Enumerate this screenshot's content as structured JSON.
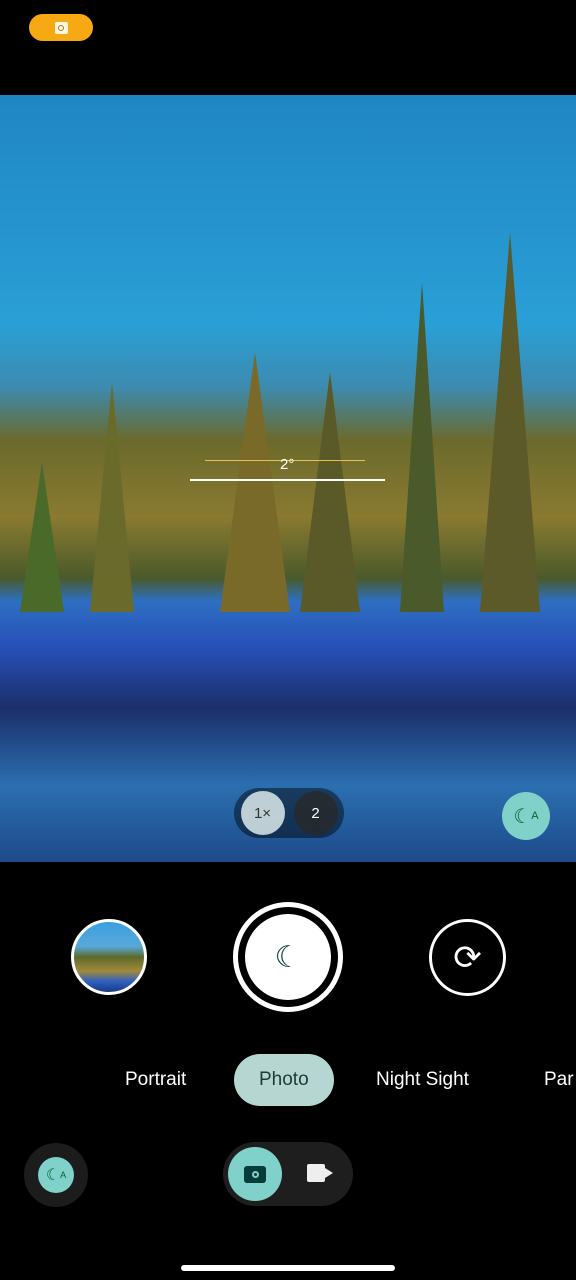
{
  "status": {
    "camera_in_use_icon": "camera-icon",
    "color": "#f6a912"
  },
  "viewfinder": {
    "level_angle": "2°",
    "zoom": {
      "options": [
        "1×",
        "2"
      ],
      "selected": "1×"
    },
    "night_auto_icon": "moon-auto-icon"
  },
  "controls": {
    "gallery_icon": "thumbnail",
    "shutter_icon": "moon-icon",
    "switch_camera_icon": "rotate-icon"
  },
  "modes": {
    "items": [
      "Portrait",
      "Photo",
      "Night Sight",
      "Par"
    ],
    "selected": "Photo"
  },
  "bottom": {
    "capture_modes": [
      "photo",
      "video"
    ],
    "selected": "photo"
  },
  "accent": "#7fd1c9"
}
